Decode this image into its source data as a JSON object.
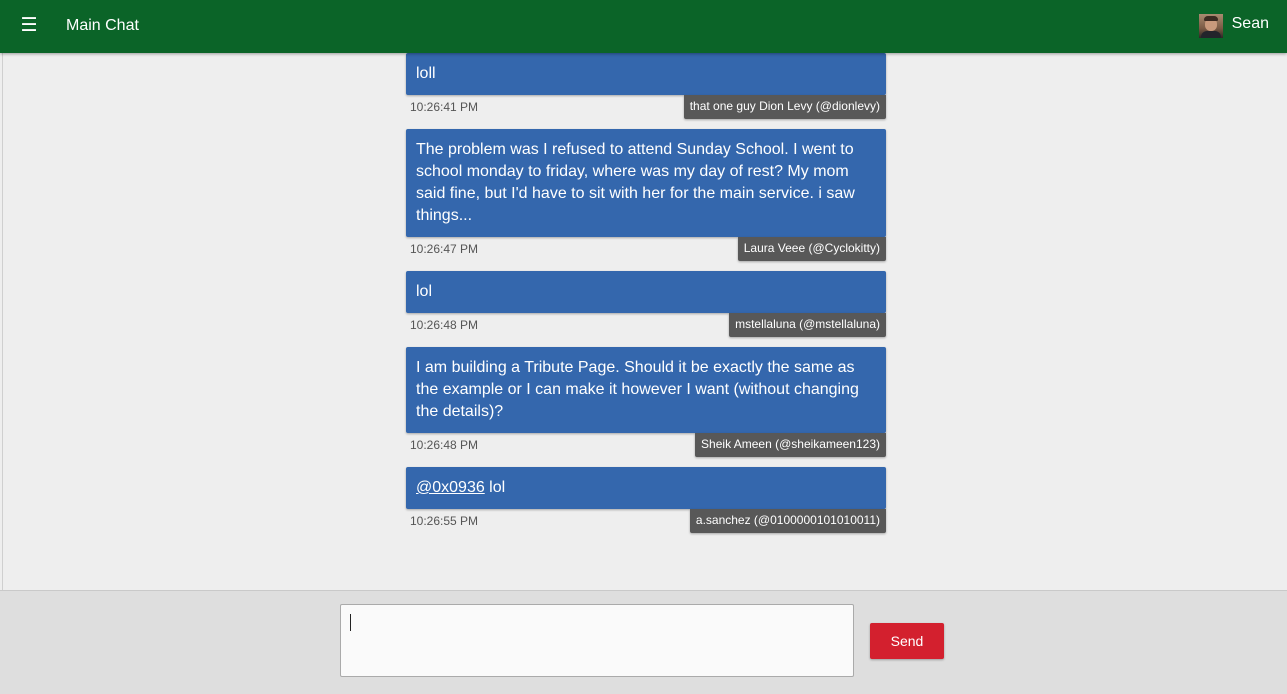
{
  "header": {
    "menu_icon": "hamburger-menu-icon",
    "menu_glyph": "☰",
    "title": "Main Chat",
    "user": {
      "name": "Sean",
      "avatar_icon": "user-avatar"
    },
    "bar_color": "#0b6428"
  },
  "messages": [
    {
      "text": "loll",
      "time": "10:26:41 PM",
      "author": "that one guy Dion Levy (@dionlevy)"
    },
    {
      "text": "The problem was I refused to attend Sunday School. I went to school monday to friday, where was my day of rest? My mom said fine, but I'd have to sit with her for the main service. i saw things...",
      "time": "10:26:47 PM",
      "author": "Laura Veee (@Cyclokitty)"
    },
    {
      "text": "lol",
      "time": "10:26:48 PM",
      "author": "mstellaluna (@mstellaluna)"
    },
    {
      "text": "I am building a Tribute Page. Should it be exactly the same as the example or I can make it however I want (without changing the details)?",
      "time": "10:26:48 PM",
      "author": "Sheik Ameen (@sheikameen123)"
    },
    {
      "mention": "@0x0936",
      "text": " lol",
      "time": "10:26:55 PM",
      "author": "a.sanchez (@0100000101010011)"
    }
  ],
  "composer": {
    "value": "",
    "send_label": "Send",
    "send_color": "#d3202e"
  },
  "colors": {
    "bubble": "#3467ad",
    "author_tag": "#585858",
    "background": "#eeeeee"
  }
}
